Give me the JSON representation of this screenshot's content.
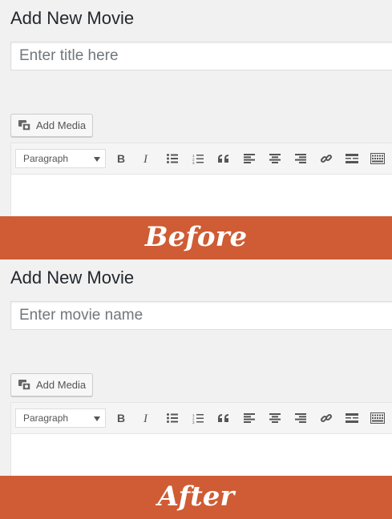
{
  "before": {
    "page_title": "Add New Movie",
    "title_placeholder": "Enter title here",
    "add_media_label": "Add Media",
    "format_select": "Paragraph",
    "banner": "Before"
  },
  "after": {
    "page_title": "Add New Movie",
    "title_placeholder": "Enter movie name",
    "add_media_label": "Add Media",
    "format_select": "Paragraph",
    "banner": "After"
  },
  "toolbar_icons": [
    "bold-icon",
    "italic-icon",
    "bulleted-list-icon",
    "numbered-list-icon",
    "blockquote-icon",
    "align-left-icon",
    "align-center-icon",
    "align-right-icon",
    "link-icon",
    "read-more-icon",
    "toolbar-toggle-icon"
  ],
  "colors": {
    "banner": "#cf5c34",
    "background": "#f1f1f1"
  }
}
